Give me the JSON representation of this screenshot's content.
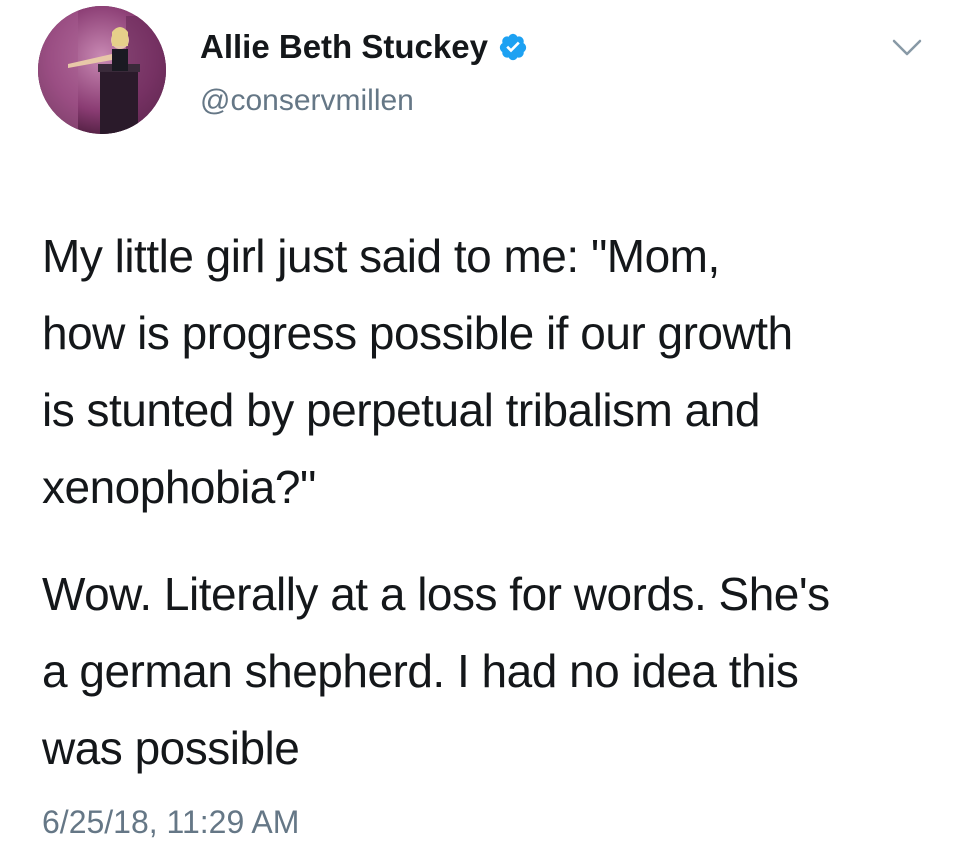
{
  "author": {
    "name": "Allie Beth Stuckey",
    "handle": "@conservmillen",
    "verified": true,
    "avatar_icon": "profile-photo"
  },
  "header": {
    "menu_icon": "chevron-down-icon"
  },
  "tweet": {
    "paragraph1": [
      "My little girl just said to me: \"Mom,",
      "how is progress possible if our growth",
      "is stunted by perpetual tribalism and",
      "xenophobia?\""
    ],
    "paragraph2": [
      "Wow. Literally at a loss for words. She's",
      "a german shepherd. I had no idea this",
      "was possible"
    ]
  },
  "timestamp": "6/25/18, 11:29 AM",
  "colors": {
    "text": "#14171a",
    "secondary": "#657786",
    "verified_blue": "#1da1f2"
  }
}
